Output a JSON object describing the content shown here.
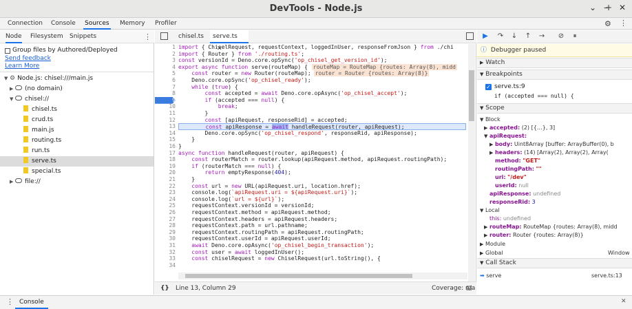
{
  "window": {
    "title": "DevTools - Node.js",
    "buttons": [
      "⌄",
      "–",
      "+",
      "✕"
    ]
  },
  "main_tabs": [
    "Connection",
    "Console",
    "Sources",
    "Memory",
    "Profiler"
  ],
  "main_active": "Sources",
  "nav": {
    "tabs": [
      "Node",
      "Filesystem",
      "Snippets"
    ],
    "group_label": "Group files by Authored/Deployed",
    "send_feedback": "Send feedback",
    "learn_more": "Learn More",
    "root": "Node.js: chisel:///main.js",
    "no_domain": "(no domain)",
    "chisel": "chisel://",
    "files": [
      "chisel.ts",
      "crud.ts",
      "main.js",
      "routing.ts",
      "run.ts",
      "serve.ts",
      "special.ts"
    ],
    "selected_file": "serve.ts",
    "file_root": "file://"
  },
  "editor": {
    "tabs": [
      "chisel.ts",
      "serve.ts"
    ],
    "active_tab": "serve.ts",
    "status_position": "Line 13, Column 29",
    "status_coverage": "Coverage: n/a",
    "breakpoint_line": 9,
    "current_line": 13,
    "line_numbers": [
      "1",
      "2",
      "3",
      "4",
      "5",
      "6",
      "7",
      "8",
      "9",
      "10",
      "11",
      "12",
      "13",
      "14",
      "15",
      "16",
      "17",
      "18",
      "19",
      "20",
      "21",
      "22",
      "23",
      "24",
      "25",
      "26",
      "27",
      "28",
      "29",
      "30",
      "31",
      "32",
      "33",
      "34"
    ],
    "lines": [
      "import { ChiselRequest, requestContext, loggedInUser, responseFromJson } from './chi",
      "import { Router } from './routing.ts';",
      "const versionId = Deno.core.opSync('op_chisel_get_version_id');",
      "export async function serve(routeMap) {",
      "    const router = new Router(routeMap);",
      "    Deno.core.opSync('op_chisel_ready');",
      "    while (true) {",
      "        const accepted = await Deno.core.opAsync('op_chisel_accept');",
      "        if (accepted === null) {",
      "            break;",
      "        }",
      "        const [apiRequest, responseRid] = accepted;",
      "        const apiResponse = await handleRequest(router, apiRequest);",
      "        Deno.core.opSync('op_chisel_respond', responseRid, apiResponse);",
      "    }",
      "}",
      "async function handleRequest(router, apiRequest) {",
      "    const routerMatch = router.lookup(apiRequest.method, apiRequest.routingPath);",
      "    if (routerMatch === null) {",
      "        return emptyResponse(404);",
      "    }",
      "    const url = new URL(apiRequest.uri, location.href);",
      "    console.log(`apiRequest.uri = ${apiRequest.uri}`);",
      "    console.log(`url = ${url}`);",
      "    requestContext.versionId = versionId;",
      "    requestContext.method = apiRequest.method;",
      "    requestContext.headers = apiRequest.headers;",
      "    requestContext.path = url.pathname;",
      "    requestContext.routingPath = apiRequest.routingPath;",
      "    requestContext.userId = apiRequest.userId;",
      "    await Deno.core.opAsync('op_chisel_begin_transaction');",
      "    const user = await loggedInUser();",
      "    const chiselRequest = new ChiselRequest(url.toString(), {",
      ""
    ],
    "inline_values": {
      "line4": "routeMap = RouteMap {routes: Array(8), midd",
      "line5": "router = Router {routes: Array(8)}"
    }
  },
  "debugger": {
    "paused": "Debugger paused",
    "watch": "Watch",
    "breakpoints": "Breakpoints",
    "bp_file": "serve.ts:9",
    "bp_code": "if (accepted === null) {",
    "scope": "Scope",
    "block": "Block",
    "accepted_name": "accepted:",
    "accepted_val": "(2) [{…}, 3]",
    "apiRequest_name": "apiRequest:",
    "body_name": "body:",
    "body_val": "Uint8Array [buffer: ArrayBuffer(0), b",
    "headers_name": "headers:",
    "headers_val": "(14) [Array(2), Array(2), Array(",
    "method_name": "method:",
    "method_val": "\"GET\"",
    "routingPath_name": "routingPath:",
    "routingPath_val": "\"\"",
    "uri_name": "uri:",
    "uri_val": "\"/dev\"",
    "userId_name": "userId:",
    "userId_val": "null",
    "apiResponse_name": "apiResponse:",
    "apiResponse_val": "undefined",
    "responseRid_name": "responseRid:",
    "responseRid_val": "3",
    "local": "Local",
    "this_name": "this:",
    "this_val": "undefined",
    "routeMap_name": "routeMap:",
    "routeMap_val": "RouteMap {routes: Array(8), midd",
    "router_name": "router:",
    "router_val": "Router {routes: Array(8)}",
    "module": "Module",
    "global": "Global",
    "global_val": "Window",
    "callstack": "Call Stack",
    "cs_fn": "serve",
    "cs_loc": "serve.ts:13"
  },
  "drawer": {
    "label": "Console"
  }
}
